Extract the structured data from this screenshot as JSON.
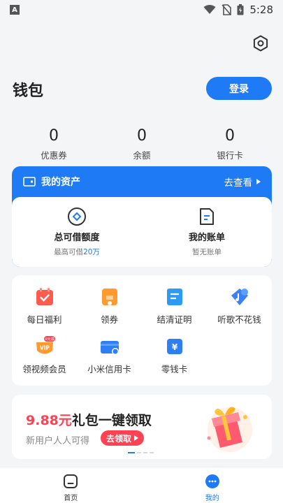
{
  "status_bar": {
    "left_badge": "A",
    "time": "5:28"
  },
  "header": {
    "title": "钱包",
    "login_label": "登录"
  },
  "stats": [
    {
      "value": "0",
      "label": "优惠券"
    },
    {
      "value": "0",
      "label": "余额"
    },
    {
      "value": "0",
      "label": "银行卡"
    }
  ],
  "assets": {
    "title": "我的资产",
    "view_label": "去查看",
    "items": [
      {
        "title": "总可借额度",
        "sub_prefix": "最高可借",
        "sub_highlight": "20万"
      },
      {
        "title": "我的账单",
        "sub_prefix": "暂无账单",
        "sub_highlight": ""
      }
    ]
  },
  "services": [
    {
      "label": "每日福利",
      "icon": "calendar-icon",
      "badge": ""
    },
    {
      "label": "领券",
      "icon": "coupon-icon",
      "badge": ""
    },
    {
      "label": "结清证明",
      "icon": "document-icon",
      "badge": ""
    },
    {
      "label": "听歌不花钱",
      "icon": "music-icon",
      "badge": ""
    },
    {
      "label": "领视频会员",
      "icon": "vip-icon",
      "badge": "0元领"
    },
    {
      "label": "小米信用卡",
      "icon": "credit-card-icon",
      "badge": ""
    },
    {
      "label": "零钱卡",
      "icon": "yuan-card-icon",
      "badge": ""
    }
  ],
  "promo": {
    "amount": "9.88元",
    "title_rest": "礼包一键领取",
    "subtitle": "新用户人人可得",
    "button_label": "去领取"
  },
  "tabbar": [
    {
      "label": "首页",
      "active": false
    },
    {
      "label": "我的",
      "active": true
    }
  ],
  "colors": {
    "accent": "#1f7bf5",
    "promo_red": "#ff4253",
    "background": "#f4f5f7"
  }
}
